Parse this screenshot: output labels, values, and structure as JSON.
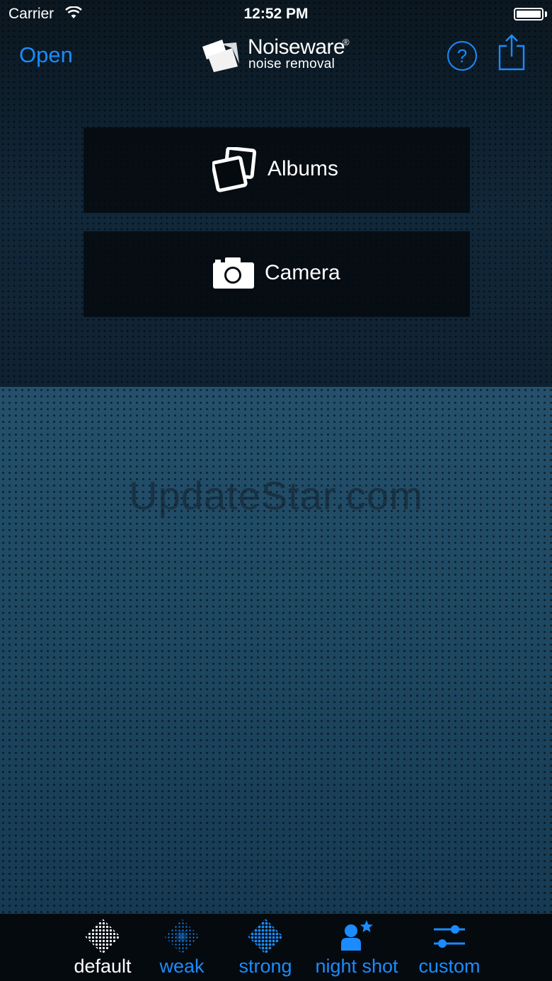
{
  "status_bar": {
    "carrier": "Carrier",
    "time": "12:52 PM",
    "battery_level": 1.0
  },
  "nav": {
    "open_label": "Open",
    "logo_name": "Noiseware",
    "logo_registered": "®",
    "logo_tagline": "noise removal",
    "help_label": "?",
    "share_icon": "share-icon"
  },
  "sources": {
    "albums_label": "Albums",
    "camera_label": "Camera"
  },
  "watermark": "UpdateStar.com",
  "toolbar": {
    "items": [
      {
        "label": "default",
        "icon": "default-preset-icon",
        "selected": true
      },
      {
        "label": "weak",
        "icon": "weak-preset-icon",
        "selected": false
      },
      {
        "label": "strong",
        "icon": "strong-preset-icon",
        "selected": false
      },
      {
        "label": "night shot",
        "icon": "night-shot-icon",
        "selected": false
      },
      {
        "label": "custom",
        "icon": "sliders-icon",
        "selected": false
      }
    ]
  },
  "colors": {
    "accent": "#1a8cff",
    "selected_text": "#ffffff",
    "toolbar_bg": "#050a0f"
  }
}
